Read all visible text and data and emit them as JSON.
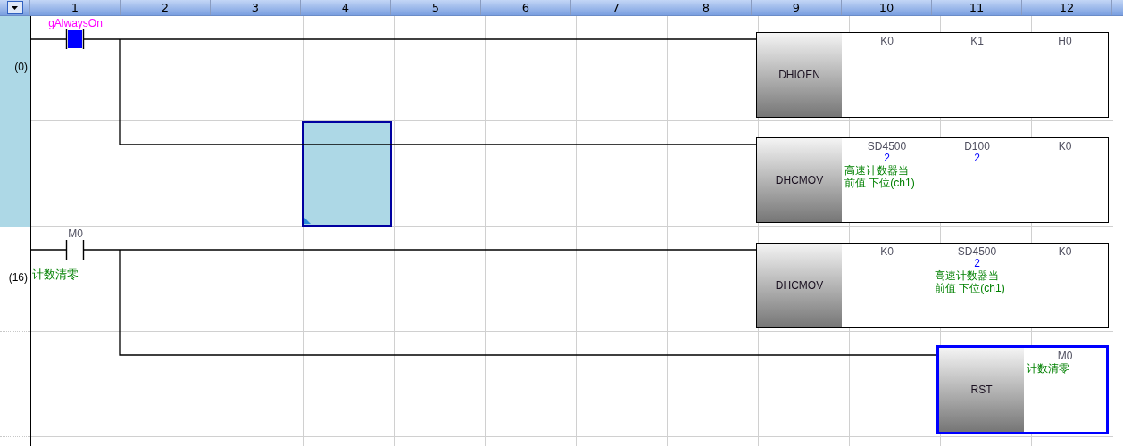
{
  "header": {
    "columns": [
      "1",
      "2",
      "3",
      "4",
      "5",
      "6",
      "7",
      "8",
      "9",
      "10",
      "11",
      "12"
    ]
  },
  "rungs": [
    {
      "step": "(0)",
      "selected": true,
      "lines": [
        {
          "selected": false,
          "contact": {
            "device": "gAlwaysOn",
            "kind": "label",
            "energized": true
          },
          "instruction": {
            "mnemonic": "DHIOEN",
            "selected": false,
            "operands": [
              {
                "device": "K0"
              },
              {
                "device": "K1"
              },
              {
                "device": "H0"
              }
            ]
          }
        },
        {
          "selected": true,
          "instruction": {
            "mnemonic": "DHCMOV",
            "selected": false,
            "operands": [
              {
                "device": "SD4500",
                "value": "2",
                "comment": "高速计数器当前值 下位(ch1)"
              },
              {
                "device": "D100",
                "value": "2"
              },
              {
                "device": "K0"
              }
            ]
          }
        }
      ]
    },
    {
      "step": "(16)",
      "selected": false,
      "lines": [
        {
          "selected": false,
          "contact": {
            "device": "M0",
            "kind": "device",
            "energized": false,
            "comment": "计数清零"
          },
          "instruction": {
            "mnemonic": "DHCMOV",
            "selected": false,
            "operands": [
              {
                "device": "K0"
              },
              {
                "device": "SD4500",
                "value": "2",
                "comment": "高速计数器当前值 下位(ch1)"
              },
              {
                "device": "K0"
              }
            ]
          }
        },
        {
          "selected": false,
          "instruction": {
            "mnemonic": "RST",
            "selected": true,
            "operands": [
              {
                "device": "M0",
                "comment": "计数清零"
              }
            ]
          }
        }
      ]
    }
  ]
}
